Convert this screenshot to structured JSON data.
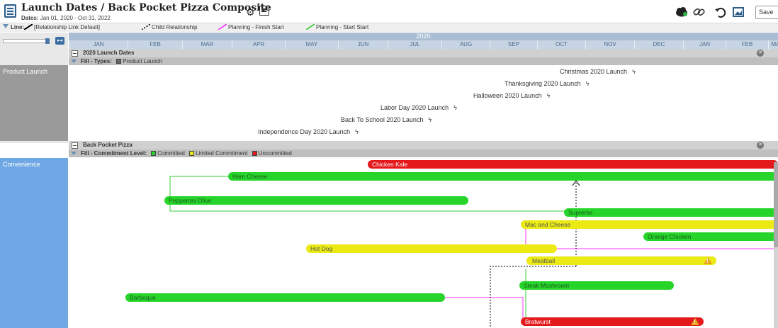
{
  "header": {
    "title": "Launch Dates / Back Pocket Pizza Composite",
    "dates_label": "Dates:",
    "dates_value": "Jan 01, 2020 - Oct 31, 2022",
    "save_label": "Save"
  },
  "legend": {
    "line_label": "Line:",
    "items": [
      "[Relationship Link Default]",
      "Child Relationship",
      "Planning - Finish Start",
      "Planning - Start Start"
    ],
    "colors": [
      "#000000",
      "#000000",
      "#ff33ff",
      "#33cc33"
    ]
  },
  "timeline": {
    "year": "2020",
    "months": [
      "JAN",
      "FEB",
      "MAR",
      "APR",
      "MAY",
      "JUN",
      "JUL",
      "AUG",
      "SEP",
      "OCT",
      "NOV",
      "DEC",
      "JAN",
      "FEB",
      "MA"
    ]
  },
  "groups": {
    "launch": {
      "title": "2020 Launch Dates",
      "fill_label": "Fill - Types:",
      "fill_types": [
        "Product Launch"
      ],
      "lane": "Product Launch",
      "milestones": [
        "Christmas 2020 Launch",
        "Thanksgiving 2020 Launch",
        "Halloween 2020 Launch",
        "Labor Day 2020 Launch",
        "Back To School 2020 Launch",
        "Independence Day 2020 Launch"
      ]
    },
    "pizza": {
      "title": "Back Pocket Pizza",
      "fill_label": "Fill - Commitment Level:",
      "levels": [
        "Committed",
        "Limited Commitment",
        "Uncommitted"
      ],
      "level_colors": [
        "#26d42a",
        "#ecea14",
        "#e3191c"
      ],
      "lane": "Convenience",
      "bars": [
        {
          "label": "Chicken Kale",
          "color": "red"
        },
        {
          "label": "Ham Cheese",
          "color": "green"
        },
        {
          "label": "Pepperoni Olive",
          "color": "green"
        },
        {
          "label": "Supreme",
          "color": "green"
        },
        {
          "label": "Mac and Cheese",
          "color": "yellow"
        },
        {
          "label": "Orange Chicken",
          "color": "green"
        },
        {
          "label": "Hot Dog",
          "color": "yellow"
        },
        {
          "label": "Meatball",
          "color": "yellow"
        },
        {
          "label": "Steak Mushroom",
          "color": "green"
        },
        {
          "label": "Barbeque",
          "color": "green"
        },
        {
          "label": "Bratwurst",
          "color": "red"
        }
      ]
    }
  }
}
